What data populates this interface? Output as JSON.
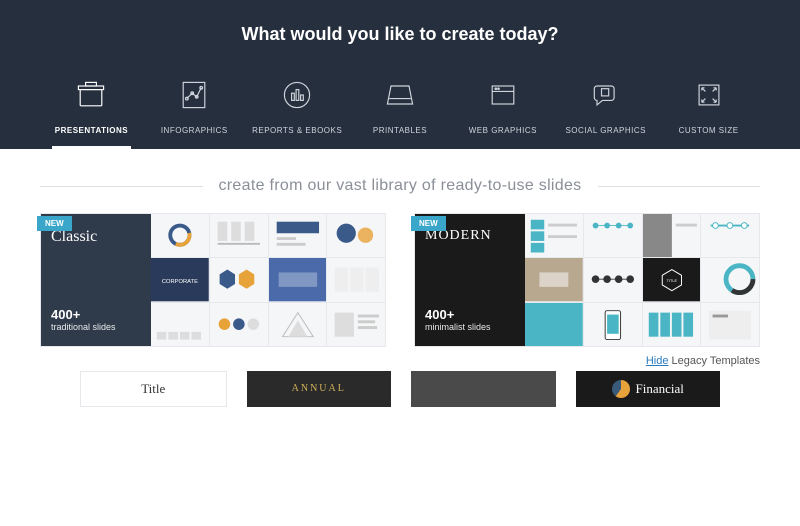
{
  "hero": {
    "title": "What would you like to create today?"
  },
  "categories": [
    {
      "label": "PRESENTATIONS",
      "name": "presentations",
      "active": true
    },
    {
      "label": "INFOGRAPHICS",
      "name": "infographics",
      "active": false
    },
    {
      "label": "REPORTS & EBOOKS",
      "name": "reports-ebooks",
      "active": false
    },
    {
      "label": "PRINTABLES",
      "name": "printables",
      "active": false
    },
    {
      "label": "WEB GRAPHICS",
      "name": "web-graphics",
      "active": false
    },
    {
      "label": "SOCIAL GRAPHICS",
      "name": "social-graphics",
      "active": false
    },
    {
      "label": "CUSTOM SIZE",
      "name": "custom-size",
      "active": false
    }
  ],
  "section": {
    "title": "create from our vast library of ready-to-use slides"
  },
  "templates": [
    {
      "badge": "NEW",
      "title": "Classic",
      "count": "400+",
      "desc": "traditional slides",
      "style": "classic"
    },
    {
      "badge": "NEW",
      "title": "MODERN",
      "count": "400+",
      "desc": "minimalist slides",
      "style": "modern"
    }
  ],
  "legacy": {
    "hide": "Hide",
    "text": "Legacy Templates"
  },
  "bottom": [
    {
      "label": "Title"
    },
    {
      "label": "ANNUAL"
    },
    {
      "label": ""
    },
    {
      "label": "Financial"
    }
  ]
}
